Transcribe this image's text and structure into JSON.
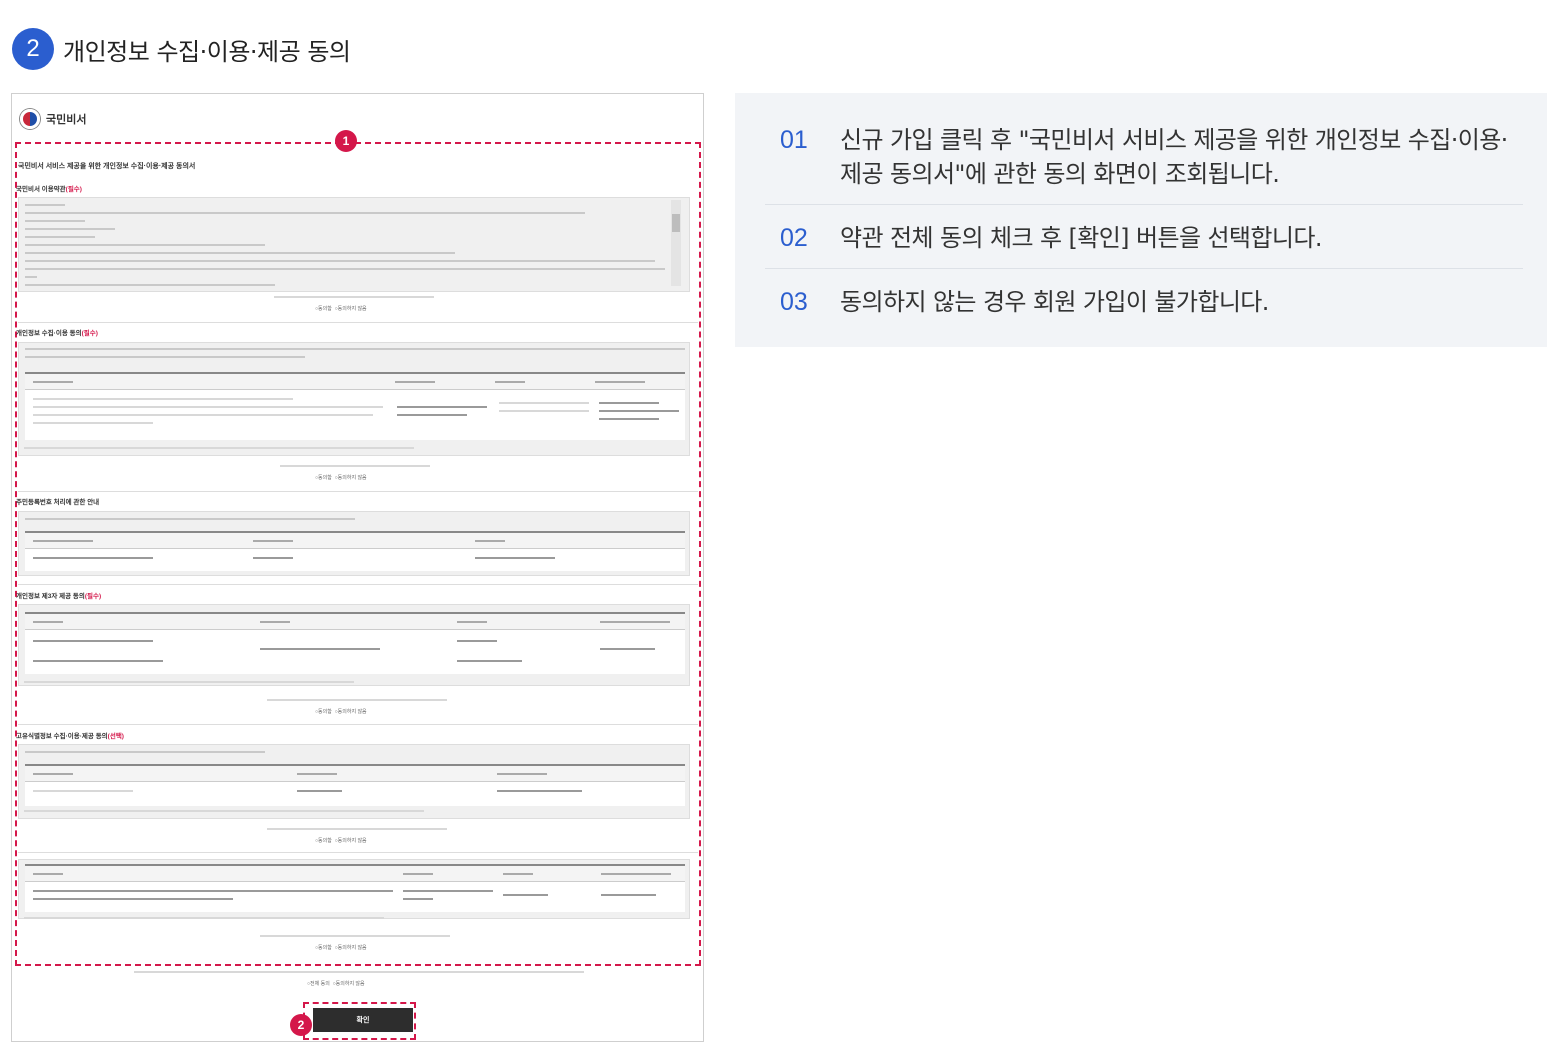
{
  "step": {
    "number": "2",
    "title": "개인정보 수집·이용·제공 동의"
  },
  "screenshot": {
    "logo_text": "국민비서",
    "badge_1": "1",
    "badge_2": "2",
    "document_title": "국민비서 서비스 제공을 위한 개인정보 수집·이용·제공 동의서",
    "section_1_title": "국민비서 이용약관",
    "section_2_title": "개인정보 수집·이용 동의",
    "section_3_title": "주민등록번호 처리에 관한 안내",
    "section_4_title": "개인정보 제3자 제공 동의",
    "section_5_title": "고유식별정보 수집·이용·제공 동의",
    "required_mark": "(필수)",
    "optional_mark": "(선택)",
    "radio_agree": "동의함",
    "radio_disagree": "동의하지 않음",
    "all_agree": "전체 동의",
    "all_disagree": "동의하지 않음",
    "confirm_label": "확인"
  },
  "instructions": [
    {
      "num": "01",
      "text": "신규 가입 클릭 후 \"국민비서 서비스 제공을 위한 개인정보 수집·이용·제공 동의서\"에 관한 동의 화면이 조회됩니다."
    },
    {
      "num": "02",
      "text": "약관 전체 동의 체크 후 [확인] 버튼을 선택합니다."
    },
    {
      "num": "03",
      "text": "동의하지 않는 경우 회원 가입이 불가합니다."
    }
  ],
  "colors": {
    "accent_blue": "#2b5ecf",
    "highlight_red": "#d4174a",
    "panel_bg": "#f2f4f7"
  }
}
